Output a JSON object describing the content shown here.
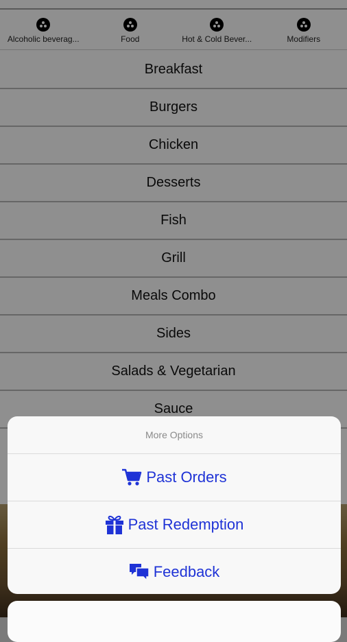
{
  "categories": [
    {
      "label": "Alcoholic beverag...",
      "icon": "category-icon"
    },
    {
      "label": "Food",
      "icon": "category-icon"
    },
    {
      "label": "Hot & Cold Bever...",
      "icon": "category-icon"
    },
    {
      "label": "Modifiers",
      "icon": "category-icon"
    }
  ],
  "menu": [
    "Breakfast",
    "Burgers",
    "Chicken",
    "Desserts",
    "Fish",
    "Grill",
    "Meals Combo",
    "Sides",
    "Salads & Vegetarian",
    "Sauce"
  ],
  "action_sheet": {
    "title": "More Options",
    "options": [
      {
        "label": "Past Orders",
        "icon": "cart-icon"
      },
      {
        "label": "Past Redemption",
        "icon": "gift-icon"
      },
      {
        "label": "Feedback",
        "icon": "chat-bubbles-icon"
      }
    ]
  },
  "colors": {
    "accent": "#1f33d6",
    "overlay": "rgba(0,0,0,0.42)"
  }
}
